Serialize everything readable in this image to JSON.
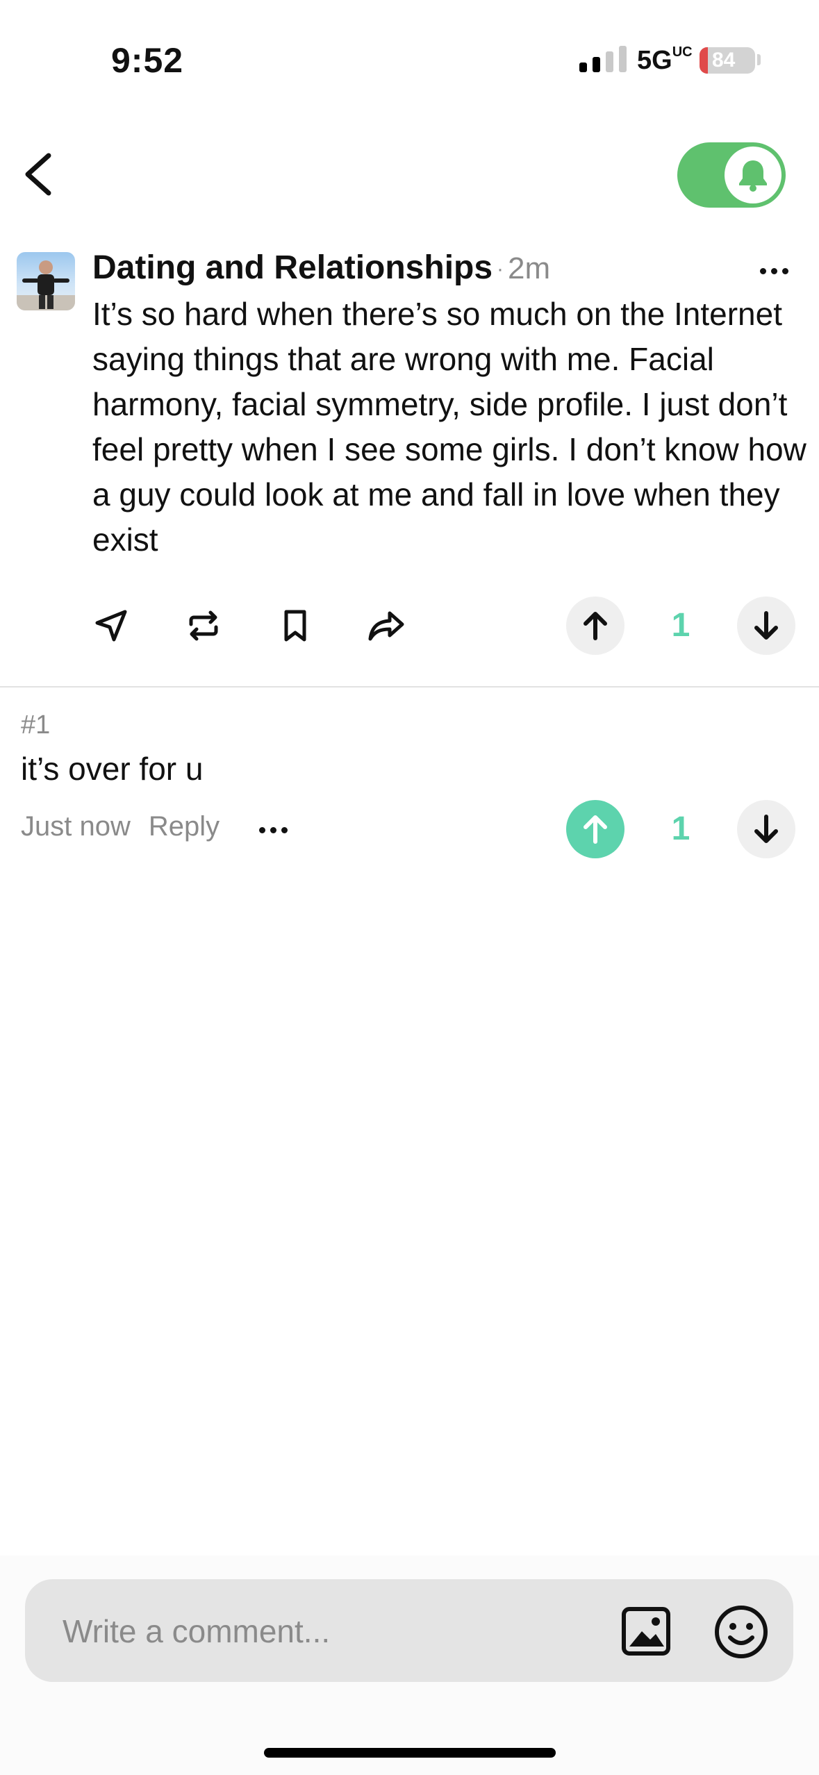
{
  "status_bar": {
    "time": "9:52",
    "network": "5G",
    "network_suffix": "UC",
    "battery": "84"
  },
  "post": {
    "community": "Dating and Relationships",
    "separator": "·",
    "age": "2m",
    "body": "It’s so hard when there’s so much on the Internet saying things that are wrong with me. Facial harmony, facial symmetry, side profile. I just don’t feel pretty when I see some girls. I don’t know how a guy could look at me and fall in love when they exist",
    "vote_count": "1"
  },
  "comment": {
    "number": "#1",
    "text": "it’s over for u",
    "time": "Just now",
    "reply_label": "Reply",
    "vote_count": "1"
  },
  "composer": {
    "placeholder": "Write a comment..."
  },
  "colors": {
    "accent": "#5dd3ad",
    "toggle_green": "#5fc16e",
    "muted_text": "#8a8a8a"
  }
}
